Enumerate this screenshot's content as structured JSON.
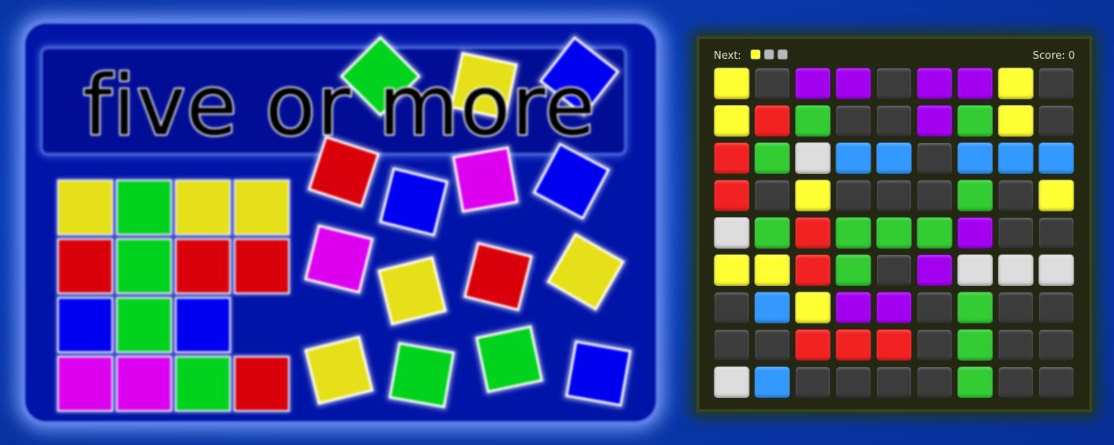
{
  "art": {
    "title": "five or more",
    "colors": {
      "yellow": "#e6e01a",
      "green": "#00d21e",
      "red": "#d9000c",
      "blue": "#0000f0",
      "magenta": "#dd00ef",
      "background": "#0014a8"
    },
    "grid_tiles": [
      [
        "yellow",
        "green",
        "yellow",
        "yellow"
      ],
      [
        "red",
        "green",
        "red",
        "red"
      ],
      [
        "blue",
        "green",
        "blue",
        null
      ],
      [
        "magenta",
        "magenta",
        "green",
        "red"
      ]
    ],
    "scattered_tiles": [
      "green",
      "yellow",
      "blue",
      "red",
      "blue",
      "magenta",
      "blue",
      "magenta",
      "yellow",
      "red",
      "yellow",
      "yellow",
      "green",
      "green",
      "blue"
    ]
  },
  "game": {
    "next_label": "Next:",
    "score_label": "Score:",
    "score_value": "0",
    "next_balls": [
      "yellow",
      "gray",
      "gray"
    ],
    "colors": {
      "yellow": "#ffff33",
      "purple": "#a300f0",
      "red": "#f22222",
      "green": "#33cc33",
      "blue": "#3399ff",
      "white": "#dddddd",
      "empty": "#3c3c3c",
      "gray": "#b8b8b8"
    },
    "board": [
      [
        "yellow",
        "empty",
        "purple",
        "purple",
        "empty",
        "purple",
        "purple",
        "yellow",
        "empty"
      ],
      [
        "yellow",
        "red",
        "green",
        "empty",
        "empty",
        "purple",
        "green",
        "yellow",
        "empty"
      ],
      [
        "red",
        "green",
        "white",
        "blue",
        "blue",
        "empty",
        "blue",
        "blue",
        "blue"
      ],
      [
        "red",
        "empty",
        "yellow",
        "empty",
        "empty",
        "empty",
        "green",
        "empty",
        "yellow"
      ],
      [
        "white",
        "green",
        "red",
        "green",
        "green",
        "green",
        "purple",
        "empty",
        "empty"
      ],
      [
        "yellow",
        "yellow",
        "red",
        "green",
        "empty",
        "purple",
        "white",
        "white",
        "white"
      ],
      [
        "empty",
        "blue",
        "yellow",
        "purple",
        "purple",
        "empty",
        "green",
        "empty",
        "empty"
      ],
      [
        "empty",
        "empty",
        "red",
        "red",
        "red",
        "empty",
        "green",
        "empty",
        "empty"
      ],
      [
        "white",
        "blue",
        "empty",
        "empty",
        "empty",
        "empty",
        "green",
        "empty",
        "empty"
      ]
    ]
  }
}
